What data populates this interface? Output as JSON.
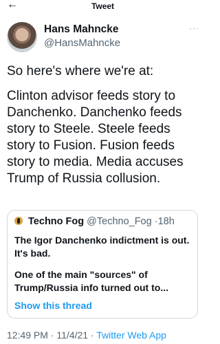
{
  "topbar": {
    "title": "Tweet",
    "back_glyph": "←"
  },
  "author": {
    "name": "Hans Mahncke",
    "handle": "@HansMahncke",
    "more_glyph": "···"
  },
  "tweet": {
    "paragraphs": [
      "So here's where we're at:",
      "Clinton advisor feeds story to Danchenko. Danchenko feeds story to Steele. Steele feeds story to Fusion. Fusion feeds story to media. Media accuses Trump of Russia collusion."
    ]
  },
  "quote": {
    "name": "Techno Fog",
    "handle": "@Techno_Fog",
    "separator": "·",
    "time": "18h",
    "paragraphs": [
      "The Igor Danchenko indictment is out. It's bad.",
      "One of the main \"sources\" of Trump/Russia info turned out to..."
    ],
    "show_thread": "Show this thread"
  },
  "footer": {
    "time": "12:49 PM",
    "date": "11/4/21",
    "separator": "·",
    "source": "Twitter Web App"
  }
}
